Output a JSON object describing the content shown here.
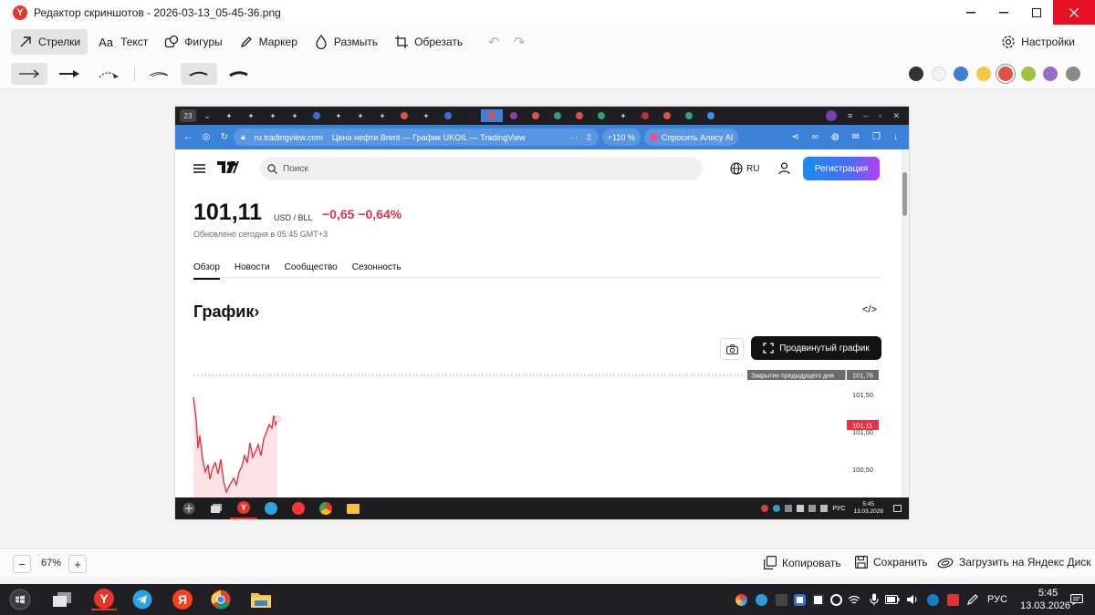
{
  "window": {
    "title": "Редактор скриншотов - 2026-03-13_05-45-36.png"
  },
  "toolbar": {
    "tools": [
      {
        "label": "Стрелки",
        "icon": "arrow-icon"
      },
      {
        "label": "Текст",
        "icon": "text-icon"
      },
      {
        "label": "Фигуры",
        "icon": "shapes-icon"
      },
      {
        "label": "Маркер",
        "icon": "marker-icon"
      },
      {
        "label": "Размыть",
        "icon": "blur-icon"
      },
      {
        "label": "Обрезать",
        "icon": "crop-icon"
      }
    ],
    "settings_label": "Настройки",
    "text_icon_glyph": "Aa"
  },
  "palette": [
    "#333333",
    "#f2f2f2",
    "#3f7fd0",
    "#f5c842",
    "#e05248",
    "#9bc53d",
    "#9b6bc7",
    "#8a8a8a"
  ],
  "browser": {
    "tab_count": "23",
    "url": "ru.tradingview.com",
    "page_title": "Цена нефти Brent — График UKOIL — TradingView",
    "zoom": "110 %",
    "alice": "Спросить Алису AI"
  },
  "tv": {
    "search_placeholder": "Поиск",
    "lang": "RU",
    "register": "Регистрация",
    "price": "101,11",
    "unit": "USD / BLL",
    "change": "−0,65 −0,64%",
    "updated": "Обновлено сегодня в 05:45 GMT+3",
    "tabs": [
      "Обзор",
      "Новости",
      "Сообщество",
      "Сезонность"
    ],
    "chart_heading": "График›",
    "embed": "</>",
    "advanced": "Продвинутый график",
    "prev_close_label": "Закрытие предыдущего дня",
    "prev_close_value": "101,76",
    "axis": [
      "101,50",
      "101,00",
      "100,50"
    ],
    "current_tag": "101,11",
    "clock": "5:45",
    "date": "13.03.2026",
    "lang_tray": "РУС"
  },
  "bottom": {
    "zoom": "67%",
    "copy": "Копировать",
    "save": "Сохранить",
    "upload": "Загрузить на Яндекс Диск"
  },
  "taskbar": {
    "lang": "РУС",
    "time": "5:45",
    "date": "13.03.2026"
  }
}
